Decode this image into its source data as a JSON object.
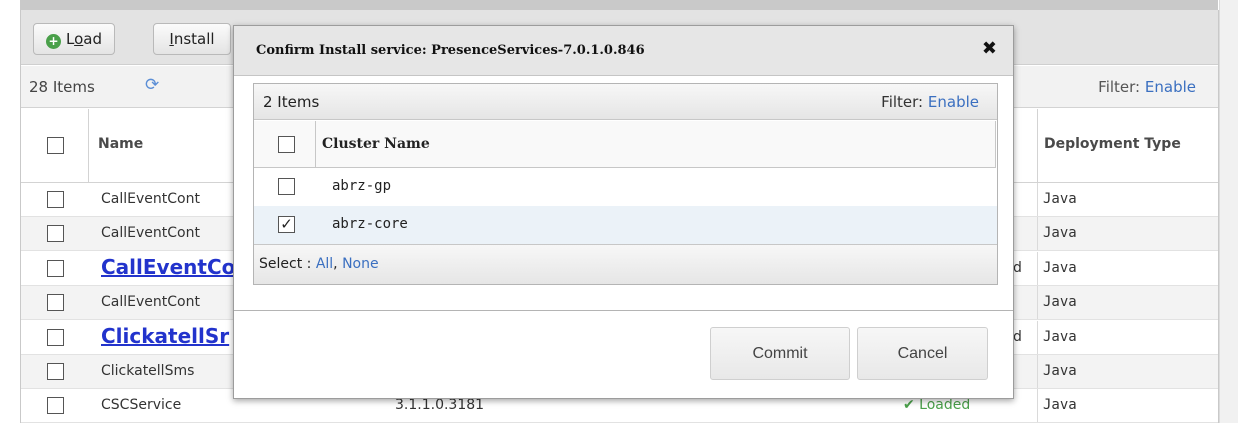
{
  "toolbar": {
    "load_label": "Load",
    "load_mnemonic": "o",
    "install_label": "Install",
    "install_mnemonic": "I"
  },
  "list": {
    "count": "28 Items",
    "filter_label": "Filter:",
    "filter_link": "Enable",
    "columns": {
      "name": "Name",
      "deployment_type": "Deployment Type"
    },
    "rows": [
      {
        "name": "CallEventCont",
        "status": "",
        "type": "Java",
        "link": false
      },
      {
        "name": "CallEventCont",
        "status": "",
        "type": "Java",
        "link": false
      },
      {
        "name": "CallEventCo",
        "status": "d",
        "type": "Java",
        "link": true
      },
      {
        "name": "CallEventCont",
        "status": "",
        "type": "Java",
        "link": false
      },
      {
        "name": "ClickatellSr",
        "status": "d",
        "type": "Java",
        "link": true
      },
      {
        "name": "ClickatellSms",
        "status": "",
        "type": "Java",
        "link": false
      },
      {
        "name": "CSCService",
        "version": "3.1.1.0.3181",
        "status": "✔ Loaded",
        "type": "Java",
        "link": false
      }
    ]
  },
  "dialog": {
    "title": "Confirm Install service: PresenceServices-7.0.1.0.846",
    "close_glyph": "✖",
    "inner": {
      "count": "2 Items",
      "filter_label": "Filter:",
      "filter_link": "Enable",
      "column": "Cluster Name",
      "rows": [
        {
          "name": "abrz-gp",
          "checked": false
        },
        {
          "name": "abrz-core",
          "checked": true
        }
      ],
      "select_label": "Select :",
      "select_all": "All",
      "select_none": "None"
    },
    "commit_label": "Commit",
    "cancel_label": "Cancel"
  },
  "colors": {
    "link": "#2233cc",
    "accent_link": "#3a6fc0",
    "selected_row": "#ebf2f8",
    "loaded_check": "#4aa04a"
  },
  "icons": [
    "add-circle-icon",
    "refresh-icon",
    "close-icon",
    "checkbox-icon",
    "checkmark-icon"
  ]
}
